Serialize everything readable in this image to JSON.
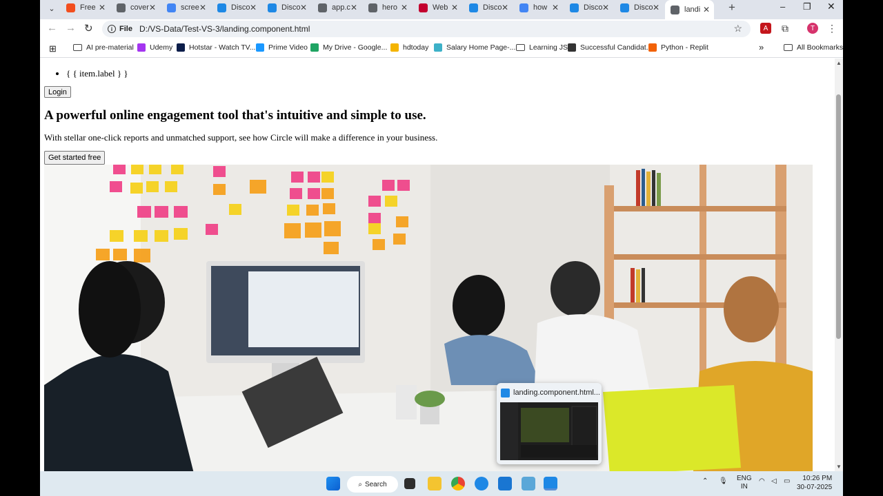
{
  "browser": {
    "tabs": [
      {
        "title": "Free",
        "icon": "figma-icon",
        "color": "#f24e1e"
      },
      {
        "title": "cover",
        "icon": "globe-icon",
        "color": "#5f6368"
      },
      {
        "title": "scree",
        "icon": "google-icon",
        "color": "#4285f4"
      },
      {
        "title": "Disco",
        "icon": "vscode-icon",
        "color": "#1e88e5"
      },
      {
        "title": "Disco",
        "icon": "vscode-icon",
        "color": "#1e88e5"
      },
      {
        "title": "app.c",
        "icon": "globe-icon",
        "color": "#5f6368"
      },
      {
        "title": "hero",
        "icon": "globe-icon",
        "color": "#5f6368"
      },
      {
        "title": "Web",
        "icon": "angular-icon",
        "color": "#c3002f"
      },
      {
        "title": "Disco",
        "icon": "vscode-icon",
        "color": "#1e88e5"
      },
      {
        "title": "how",
        "icon": "google-icon",
        "color": "#4285f4"
      },
      {
        "title": "Disco",
        "icon": "vscode-icon",
        "color": "#1e88e5"
      },
      {
        "title": "Disco",
        "icon": "vscode-icon",
        "color": "#1e88e5"
      },
      {
        "title": "landi",
        "icon": "globe-icon",
        "color": "#5f6368",
        "active": true
      }
    ],
    "address": {
      "chip": "File",
      "url": "D:/VS-Data/Test-VS-3/landing.component.html"
    },
    "bookmarks": [
      {
        "label": "AI pre-material",
        "icon": "folder-icon"
      },
      {
        "label": "Udemy",
        "icon": "udemy-icon",
        "color": "#a435f0"
      },
      {
        "label": "Hotstar - Watch TV...",
        "icon": "hotstar-icon",
        "color": "#0c1d4a"
      },
      {
        "label": "Prime Video",
        "icon": "prime-video-icon",
        "color": "#1a98ff"
      },
      {
        "label": "My Drive - Google...",
        "icon": "drive-icon",
        "color": "#1fa463"
      },
      {
        "label": "hdtoday",
        "icon": "hdtoday-icon",
        "color": "#f4b400"
      },
      {
        "label": "Salary Home Page-...",
        "icon": "salary-icon",
        "color": "#3db1c8"
      },
      {
        "label": "Learning JS",
        "icon": "folder-icon"
      },
      {
        "label": "Successful Candidat...",
        "icon": "search-q-icon",
        "color": "#333333"
      },
      {
        "label": "Python - Replit",
        "icon": "replit-icon",
        "color": "#f26207"
      }
    ],
    "all_bookmarks": "All Bookmarks"
  },
  "page": {
    "nav_item": "{ { item.label } }",
    "login": "Login",
    "title": "A powerful online engagement tool that's intuitive and simple to use.",
    "subtitle": "With stellar one-click reports and unmatched support, see how Circle will make a difference in your business.",
    "cta": "Get started free"
  },
  "preview": {
    "title": "landing.component.html..."
  },
  "taskbar": {
    "search": "Search",
    "lang_top": "ENG",
    "lang_bottom": "IN",
    "time": "10:26 PM",
    "date": "30-07-2025"
  }
}
